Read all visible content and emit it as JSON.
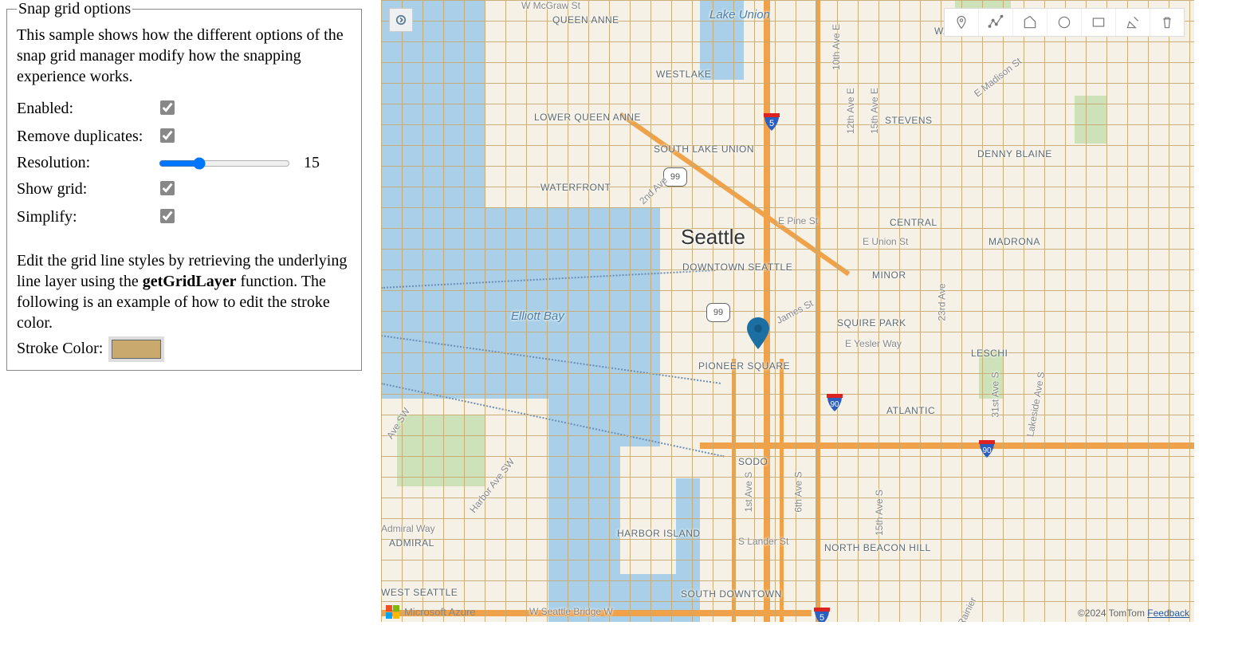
{
  "panel": {
    "legend": "Snap grid options",
    "desc": "This sample shows how the different options of the snap grid manager modify how the snapping experience works.",
    "enabled_label": "Enabled:",
    "enabled": true,
    "remove_dup_label": "Remove duplicates:",
    "remove_dup": true,
    "resolution_label": "Resolution:",
    "resolution": 15,
    "show_grid_label": "Show grid:",
    "show_grid": true,
    "simplify_label": "Simplify:",
    "simplify": true,
    "para2_pre": "Edit the grid line styles by retrieving the underlying line layer using the ",
    "para2_bold": "getGridLayer",
    "para2_post": " function. The following is an example of how to edit the stroke color.",
    "stroke_label": "Stroke Color:",
    "stroke_color": "#c9a96e"
  },
  "map": {
    "city_label": "Seattle",
    "water_labels": {
      "elliott_bay": "Elliott Bay",
      "lake_union": "Lake Union"
    },
    "areas": {
      "queen_anne": "QUEEN ANNE",
      "westlake": "WESTLAKE",
      "lower_qa": "LOWER QUEEN ANNE",
      "slu": "SOUTH LAKE UNION",
      "waterfront": "WATERFRONT",
      "downtown": "DOWNTOWN SEATTLE",
      "pioneer": "PIONEER SQUARE",
      "sodo": "SODO",
      "harbor_island": "HARBOR ISLAND",
      "admiral": "ADMIRAL",
      "west_seattle": "WEST SEATTLE",
      "south_downtown": "SOUTH DOWNTOWN",
      "stevens": "STEVENS",
      "denny_blaine": "DENNY BLAINE",
      "central": "CENTRAL",
      "madrona": "MADRONA",
      "minor": "MINOR",
      "squire": "SQUIRE PARK",
      "leschi": "LESCHI",
      "atlantic": "ATLANTIC",
      "nbh": "NORTH BEACON HILL",
      "washin": "WASHIN"
    },
    "streets": {
      "pine": "E Pine St",
      "union": "E Union St",
      "yesler": "E Yesler Way",
      "lander": "S Lander St",
      "bridge": "W Seattle Bridge W",
      "admiral_way": "Admiral Way",
      "mcgraw": "W McGraw St",
      "madison": "E Madison St",
      "10th": "10th Ave E",
      "12th": "12th Ave E",
      "15th": "15th Ave E",
      "23rd": "23rd Ave",
      "31st": "31st Ave S",
      "lakeside": "Lakeside Ave S",
      "6th": "6th Ave S",
      "1st": "1st Ave S",
      "2nd": "2nd Ave",
      "james": "James St",
      "15s": "15th Ave S",
      "harbor_sw": "Harbor Ave SW",
      "ave_sw": "Ave SW",
      "rainier": "Rainier"
    },
    "shields": {
      "sr99": "99",
      "i5": "5",
      "i90": "90"
    },
    "toolbar": {
      "point": "draw-point",
      "line": "draw-line",
      "polygon": "draw-polygon",
      "circle": "draw-circle",
      "rect": "draw-rectangle",
      "edit": "edit-geometry",
      "delete": "erase-geometry"
    },
    "attribution": "Microsoft Azure",
    "copyright": "©2024 TomTom",
    "feedback": "Feedback"
  }
}
